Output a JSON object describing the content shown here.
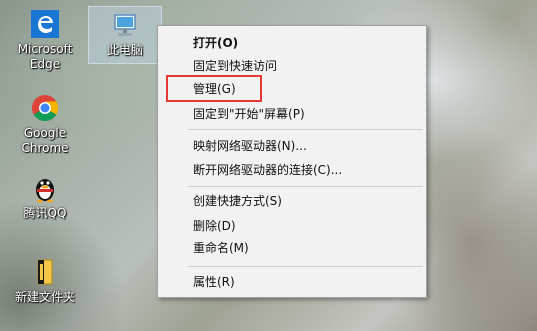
{
  "desktop": {
    "icons": [
      {
        "label": "Microsoft Edge",
        "icon": "edge-icon"
      },
      {
        "label": "此电脑",
        "icon": "computer-icon"
      },
      {
        "label": "Google Chrome",
        "icon": "chrome-icon"
      },
      {
        "label": "腾讯QQ",
        "icon": "qq-penguin-icon"
      },
      {
        "label": "新建文件夹",
        "icon": "folder-icon"
      }
    ]
  },
  "context_menu": {
    "items": [
      {
        "label": "打开(O)",
        "bold": true
      },
      {
        "label": "固定到快速访问"
      },
      {
        "label": "管理(G)",
        "highlighted": true
      },
      {
        "label": "固定到\"开始\"屏幕(P)"
      },
      {
        "label": "映射网络驱动器(N)..."
      },
      {
        "label": "断开网络驱动器的连接(C)..."
      },
      {
        "label": "创建快捷方式(S)"
      },
      {
        "label": "删除(D)"
      },
      {
        "label": "重命名(M)"
      },
      {
        "label": "属性(R)"
      }
    ]
  },
  "colors": {
    "highlight_box": "#e53935",
    "menu_background": "#f2f2f2",
    "edge_blue": "#1976d2"
  }
}
